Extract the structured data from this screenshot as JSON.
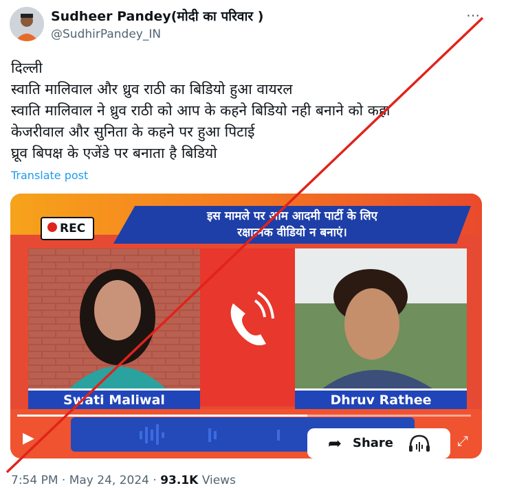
{
  "author": {
    "name": "Sudheer Pandey(मोदी का परिवार )",
    "handle": "@SudhirPandey_IN"
  },
  "more_icon": "⋯",
  "tweet_lines": [
    "दिल्ली",
    "स्वाति मालिवाल और ध्रुव राठी का बिडियो हुआ वायरल",
    "स्वाति मालिवाल ने ध्रुव राठी को आप के कहने बिडियो नही बनाने को कहा",
    "केजरीवाल और सुनिता के कहने पर हुआ पिटाई",
    "घ्रूव बिपक्ष के एजेंडे पर बनाता है बिडियो"
  ],
  "translate_label": "Translate post",
  "media": {
    "rec_label": "REC",
    "headline_line1": "इस मामले पर आम आदमी पार्टी के लिए",
    "headline_line2": "रक्षात्मक वीडियो न बनाएं।",
    "left_name": "Swati Maliwal",
    "right_name": "Dhruv Rathee",
    "progress": 0.64,
    "share_label": "Share",
    "icons": [
      "rec-dot",
      "phone-icon",
      "play-icon",
      "share-arrow-icon",
      "headphones-icon",
      "expand-icon"
    ]
  },
  "meta": {
    "time": "7:54 PM",
    "sep1": " · ",
    "date": "May 24, 2024",
    "sep2": " · ",
    "views_count": "93.1K",
    "views_label": " Views"
  },
  "colors": {
    "link": "#1d9bf0",
    "overlay_cross": "#e0231b",
    "banner_blue": "#2045b8"
  }
}
